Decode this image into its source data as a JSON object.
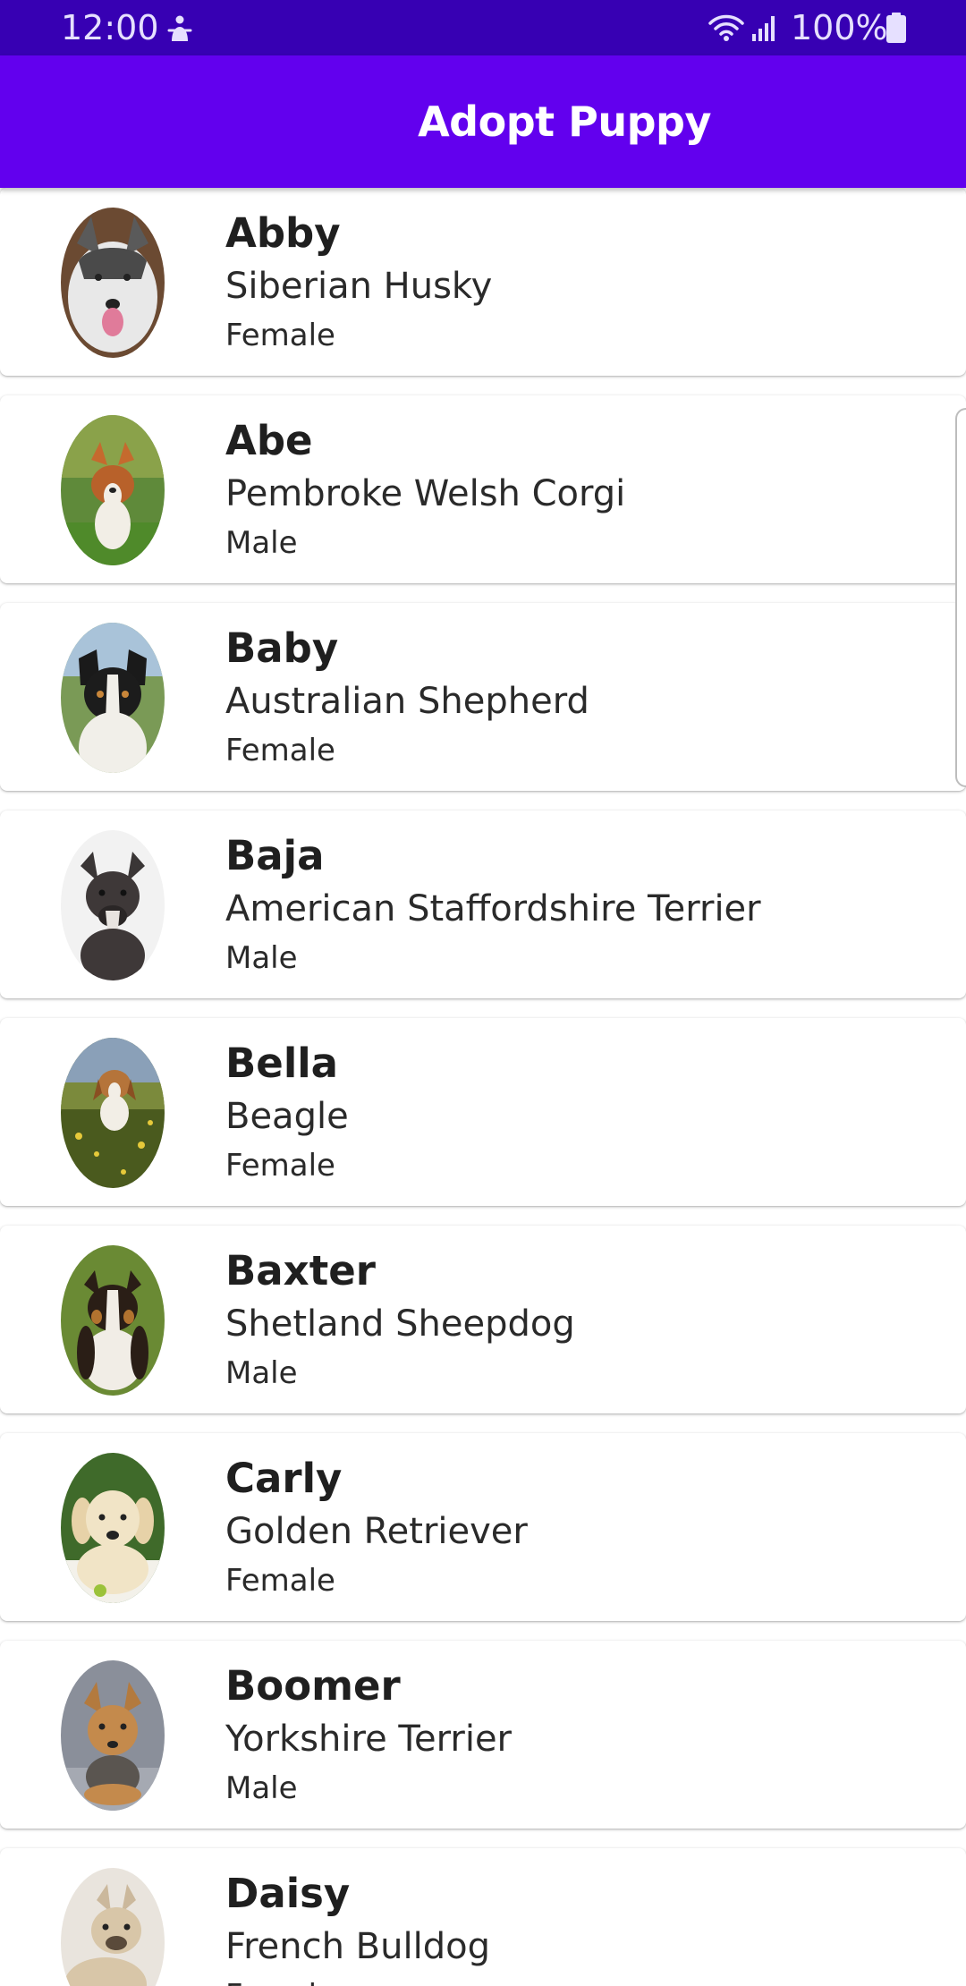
{
  "status_bar": {
    "time": "12:00",
    "battery_text": "100%",
    "icons": [
      "accessibility-icon",
      "wifi-icon",
      "signal-icon",
      "battery-icon"
    ]
  },
  "app_bar": {
    "title": "Adopt Puppy",
    "color": "#6200ee",
    "status_color": "#3700b3"
  },
  "puppies": [
    {
      "name": "Abby",
      "breed": "Siberian Husky",
      "sex": "Female"
    },
    {
      "name": "Abe",
      "breed": "Pembroke Welsh Corgi",
      "sex": "Male"
    },
    {
      "name": "Baby",
      "breed": "Australian Shepherd",
      "sex": "Female"
    },
    {
      "name": "Baja",
      "breed": "American Staffordshire Terrier",
      "sex": "Male"
    },
    {
      "name": "Bella",
      "breed": "Beagle",
      "sex": "Female"
    },
    {
      "name": "Baxter",
      "breed": "Shetland Sheepdog",
      "sex": "Male"
    },
    {
      "name": "Carly",
      "breed": "Golden Retriever",
      "sex": "Female"
    },
    {
      "name": "Boomer",
      "breed": "Yorkshire Terrier",
      "sex": "Male"
    },
    {
      "name": "Daisy",
      "breed": "French Bulldog",
      "sex": "Female"
    }
  ]
}
